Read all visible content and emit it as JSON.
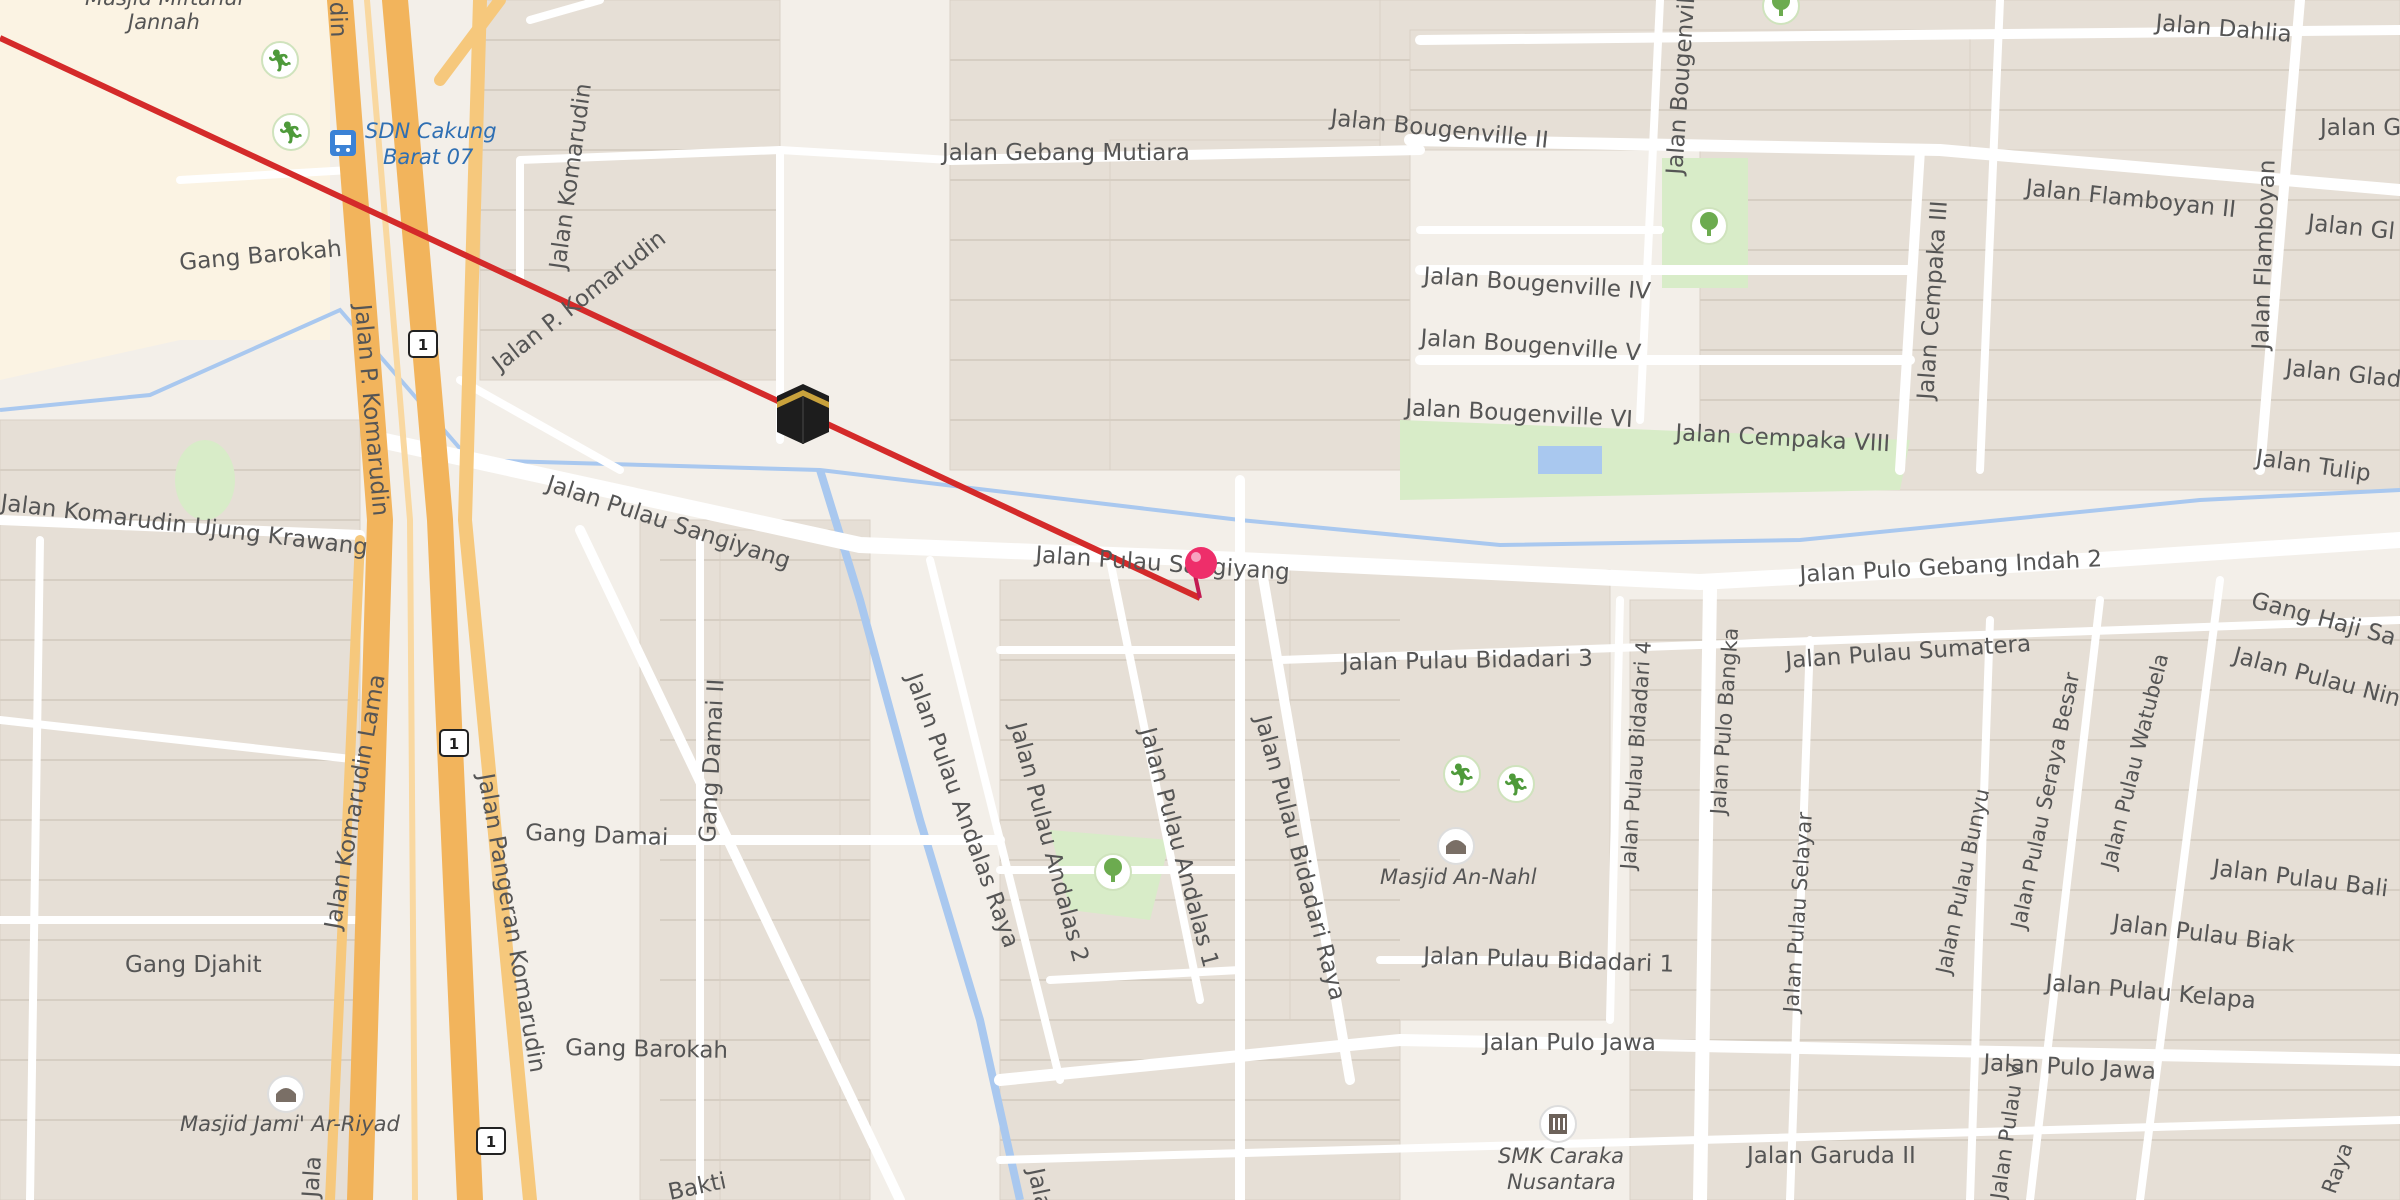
{
  "map": {
    "colors": {
      "background": "#f3efe9",
      "block": "#e8e1d8",
      "road": "#ffffff",
      "highway": "#f2b45c",
      "water": "#a9c8ef",
      "park": "#d8ecc8",
      "qibla_line": "#d42a2a",
      "marker": "#ee2e6a"
    },
    "streets": {
      "gebang_mutiara": "Jalan Gebang Mutiara",
      "bougenville_ii": "Jalan Bougenville II",
      "bougenville_iv": "Jalan Bougenville IV",
      "bougenville_v": "Jalan Bougenville V",
      "bougenville_vi": "Jalan Bougenville VI",
      "bougenville_vert": "Jalan Bougenville",
      "cempaka_viii": "Jalan Cempaka VIII",
      "cempaka_iii": "Jalan Cempaka III",
      "flamboyan_ii": "Jalan Flamboyan II",
      "flamboyan": "Jalan Flamboyan",
      "dahlia": "Jalan Dahlia",
      "tulip": "Jalan Tulip",
      "gla1": "Jalan Gla",
      "gla2": "Jalan Gl",
      "gla3": "Jalan Glad",
      "gang_barokah_top": "Gang Barokah",
      "p_komarudin_top": "Jalan P. Komarudin",
      "komarudin_vert": "Jalan Komarudin",
      "p_komarudin_vert": "Jalan P. Komarudin",
      "komarudin_ujung": "Jalan Komarudin Ujung Krawang",
      "pangeran_komarudin": "Jalan Pangeran Komarudin",
      "komarudin_lama": "Jalan Komarudin Lama",
      "pulau_sangiyang_left": "Jalan Pulau Sangiyang",
      "pulau_sangiyang_mid": "Jalan Pulau Sangiyang",
      "pulo_gebang_indah_2": "Jalan Pulo Gebang Indah 2",
      "pulau_bidadari_3": "Jalan Pulau Bidadari 3",
      "pulau_sumatera": "Jalan Pulau Sumatera",
      "gang_haji": "Gang Haji Sa",
      "jalan_nin": "Jalan Pulau Nin",
      "pulau_bidadari_4": "Jalan Pulau Bidadari 4",
      "pulo_bangka": "Jalan Pulo Bangka",
      "pulau_selayar": "Jalan Pulau Selayar",
      "pulau_bunyu": "Jalan Pulau Bunyu",
      "pulau_seraya_besar": "Jalan Pulau Seraya Besar",
      "pulau_watubela": "Jalan Pulau Watubela",
      "pulau_bali": "Jalan Pulau Bali",
      "pulau_biak": "Jalan Pulau Biak",
      "pulau_kelapa": "Jalan Pulau Kelapa",
      "pulo_jawa_1": "Jalan Pulo Jawa",
      "pulo_jawa_2": "Jalan Pulo Jawa",
      "garuda_ii": "Jalan Garuda II",
      "pulau_bidadari_1": "Jalan Pulau Bidadari 1",
      "pulau_bidadari_raya": "Jalan Pulau Bidadari Raya",
      "pulau_andalas_raya": "Jalan Pulau Andalas Raya",
      "pulau_andalas_2": "Jalan Pulau Andalas 2",
      "pulau_andalas_1": "Jalan Pulau Andalas 1",
      "gang_damai_ii": "Gang Damai II",
      "gang_damai": "Gang Damai",
      "gang_djahit": "Gang Djahit",
      "gang_barokah_bottom": "Gang Barokah",
      "bakti": "Bakti",
      "jala_bottom": "Jala",
      "ja_bottom": "Jala",
      "raya_bottom": "Raya",
      "pulau_v": "Jalan Pulau V",
      "komarudin_lama_bottom": "Jala",
      "edge_komarudin": "din"
    },
    "pois": {
      "sdn_line1": "SDN Cakung",
      "sdn_line2": "Barat 07",
      "masjid_top_line1": "Masjid Miftahul",
      "masjid_top_line2": "Jannah",
      "masjid_an_nahl": "Masjid An-Nahl",
      "masjid_ar_riyad": "Masjid Jami' Ar-Riyad",
      "smk_line1": "SMK Caraka",
      "smk_line2": "Nusantara"
    },
    "shields": {
      "top": "1",
      "mid": "1",
      "bottom": "1"
    },
    "icons": {
      "kaaba": "kaaba-icon",
      "marker": "location-pin-icon",
      "park": "tree-icon",
      "sports": "sports-icon",
      "bus": "bus-stop-icon",
      "mosque": "mosque-icon",
      "school": "school-icon"
    }
  }
}
